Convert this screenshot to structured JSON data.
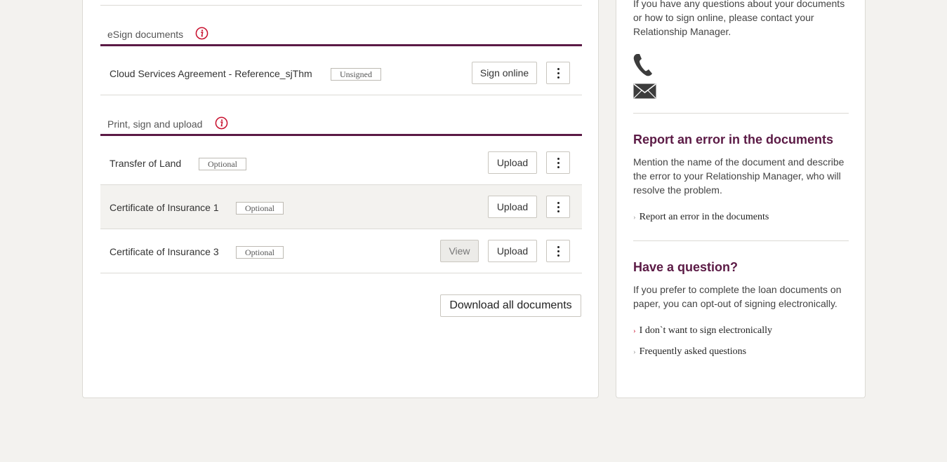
{
  "esign": {
    "title": "eSign documents",
    "rows": [
      {
        "name": "Cloud Services Agreement - Reference_sjThm",
        "badge": "Unsigned",
        "action": "Sign online"
      }
    ]
  },
  "print_sign": {
    "title": "Print, sign and upload",
    "rows": [
      {
        "name": "Transfer of Land",
        "badge": "Optional",
        "action": "Upload"
      },
      {
        "name": "Certificate of Insurance 1",
        "badge": "Optional",
        "action": "Upload"
      },
      {
        "name": "Certificate of Insurance 3",
        "badge": "Optional",
        "view": "View",
        "action": "Upload"
      }
    ]
  },
  "download_all": "Download all documents",
  "sidebar": {
    "contact_text": "If you have any questions about your documents or how to sign online, please contact your Relationship Manager.",
    "report": {
      "heading": "Report an error in the documents",
      "text": "Mention the name of the document and describe the error to your Relationship Manager, who will resolve the problem.",
      "link": "Report an error in the documents"
    },
    "question": {
      "heading": "Have a question?",
      "text": "If you prefer to complete the loan documents on paper, you can opt-out of signing electronically.",
      "link1": "I don`t want to sign electronically",
      "link2": "Frequently asked questions"
    }
  },
  "colors": {
    "accent": "#5b1a45",
    "info_icon": "#c8102e",
    "background": "#f3f2ef"
  },
  "icons": {
    "info": "info-circle-icon",
    "phone": "phone-icon",
    "email": "envelope-icon",
    "more": "more-vertical-icon"
  }
}
